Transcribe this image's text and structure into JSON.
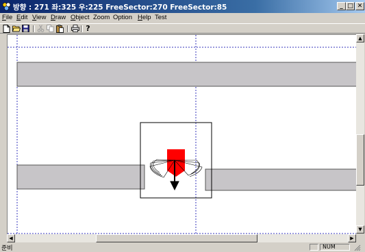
{
  "window": {
    "title": "방향 : 271  좌:325 우:225 FreeSector:270 FreeSector:85",
    "buttons": {
      "minimize": "_",
      "maximize": "□",
      "close": "✕"
    }
  },
  "menu": [
    {
      "label": "File",
      "accel": "F",
      "rest": "ile"
    },
    {
      "label": "Edit",
      "accel": "E",
      "rest": "dit"
    },
    {
      "label": "View",
      "accel": "V",
      "rest": "iew"
    },
    {
      "label": "Draw",
      "accel": "D",
      "rest": "raw"
    },
    {
      "label": "Object",
      "accel": "O",
      "rest": "bject"
    },
    {
      "label": "Zoom",
      "accel": "",
      "rest": "Zoom"
    },
    {
      "label": "Option",
      "accel": "",
      "rest": "Option"
    },
    {
      "label": "Help",
      "accel": "H",
      "rest": "elp"
    },
    {
      "label": "Test",
      "accel": "",
      "rest": "Test"
    }
  ],
  "toolbar": [
    {
      "name": "new-file-icon",
      "glyph": "🗋",
      "enabled": true
    },
    {
      "name": "open-folder-icon",
      "glyph": "📂",
      "enabled": true
    },
    {
      "name": "save-icon",
      "glyph": "💾",
      "enabled": true
    },
    {
      "name": "cut-icon",
      "glyph": "✂",
      "enabled": false
    },
    {
      "name": "copy-icon",
      "glyph": "⎘",
      "enabled": false
    },
    {
      "name": "paste-icon",
      "glyph": "📋",
      "enabled": true
    },
    {
      "name": "print-icon",
      "glyph": "🖶",
      "enabled": true
    },
    {
      "name": "help-icon",
      "glyph": "?",
      "enabled": true
    }
  ],
  "scene": {
    "colors": {
      "wall": "#c7c5c8",
      "guide_line": "#3333bb",
      "robot_body": "#ff0000",
      "heading_arrow": "#000000",
      "sensor_fan": "#000000"
    },
    "robot": {
      "heading": "down",
      "heading_degrees": 271
    }
  },
  "status": {
    "text": "준비",
    "num": "NUM"
  }
}
